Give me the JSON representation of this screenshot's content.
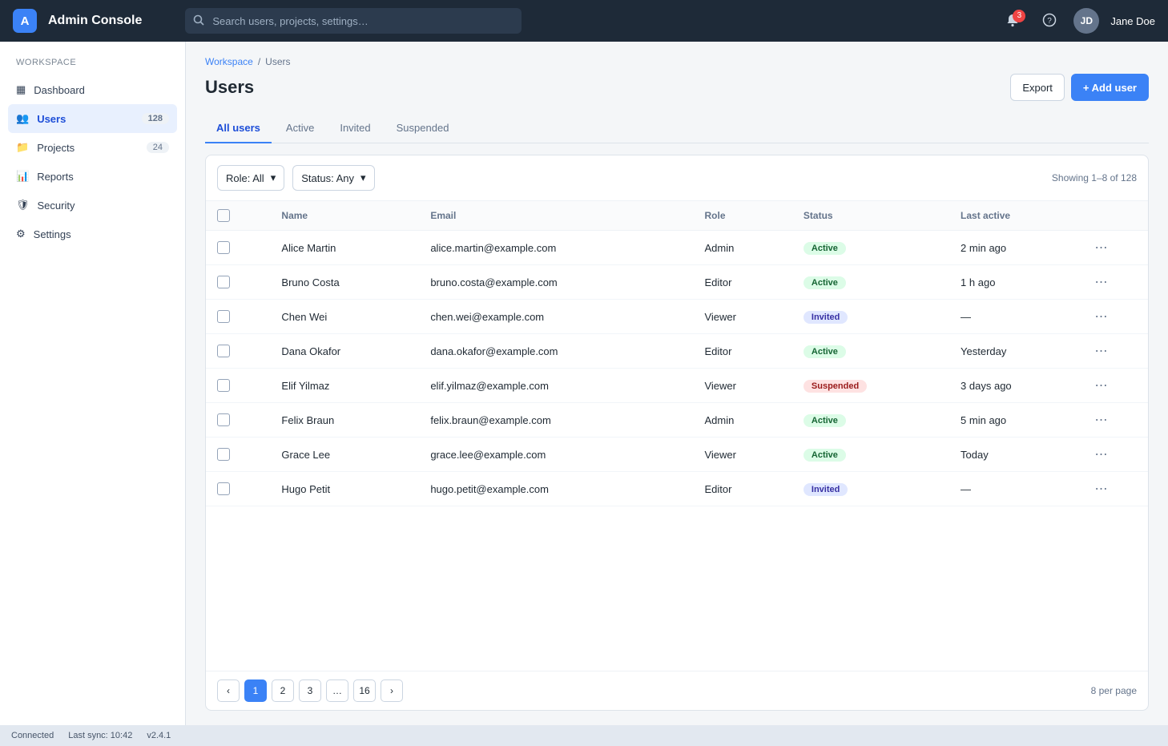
{
  "header": {
    "logo_letter": "A",
    "app_title": "Admin Console",
    "search_placeholder": "Search users, projects, settings…",
    "notifications_count": "3",
    "user_initials": "JD",
    "user_name": "Jane Doe"
  },
  "sidebar": {
    "heading": "Workspace",
    "items": [
      {
        "icon": "dashboard-icon",
        "glyph": "▦",
        "label": "Dashboard",
        "count": ""
      },
      {
        "icon": "users-icon",
        "glyph": "👥",
        "label": "Users",
        "count": "128"
      },
      {
        "icon": "folder-icon",
        "glyph": "📁",
        "label": "Projects",
        "count": "24"
      },
      {
        "icon": "chart-icon",
        "glyph": "📊",
        "label": "Reports",
        "count": ""
      },
      {
        "icon": "shield-icon",
        "glyph": "🛡",
        "label": "Security",
        "count": ""
      },
      {
        "icon": "gear-icon",
        "glyph": "⚙",
        "label": "Settings",
        "count": ""
      }
    ],
    "active_index": 1
  },
  "main": {
    "breadcrumb": [
      "Workspace",
      "Users"
    ],
    "title": "Users",
    "export_label": "Export",
    "add_label": "+ Add user",
    "tabs": [
      "All users",
      "Active",
      "Invited",
      "Suspended"
    ],
    "active_tab": 0,
    "filter_role": "Role: All",
    "filter_status": "Status: Any",
    "result_count": "Showing 1–8 of 128",
    "columns": [
      "",
      "Name",
      "Email",
      "Role",
      "Status",
      "Last active",
      ""
    ],
    "rows": [
      [
        "Alice Martin",
        "alice.martin@example.com",
        "Admin",
        "Active",
        "2 min ago"
      ],
      [
        "Bruno Costa",
        "bruno.costa@example.com",
        "Editor",
        "Active",
        "1 h ago"
      ],
      [
        "Chen Wei",
        "chen.wei@example.com",
        "Viewer",
        "Invited",
        "—"
      ],
      [
        "Dana Okafor",
        "dana.okafor@example.com",
        "Editor",
        "Active",
        "Yesterday"
      ],
      [
        "Elif Yilmaz",
        "elif.yilmaz@example.com",
        "Viewer",
        "Suspended",
        "3 days ago"
      ],
      [
        "Felix Braun",
        "felix.braun@example.com",
        "Admin",
        "Active",
        "5 min ago"
      ],
      [
        "Grace Lee",
        "grace.lee@example.com",
        "Viewer",
        "Active",
        "Today"
      ],
      [
        "Hugo Petit",
        "hugo.petit@example.com",
        "Editor",
        "Invited",
        "—"
      ]
    ],
    "status_colors": {
      "Active": {
        "bg": "#dcfce7",
        "fg": "#166534"
      },
      "Invited": {
        "bg": "#e0e7ff",
        "fg": "#3730a3"
      },
      "Suspended": {
        "bg": "#fee2e2",
        "fg": "#991b1b"
      }
    },
    "pager": {
      "prev": "‹",
      "pages": [
        "1",
        "2",
        "3",
        "…",
        "16"
      ],
      "current": "1",
      "next": "›",
      "info": "8 per page"
    }
  },
  "statusbar": {
    "left": "Connected",
    "middle": "Last sync: 10:42",
    "right": "v2.4.1"
  }
}
